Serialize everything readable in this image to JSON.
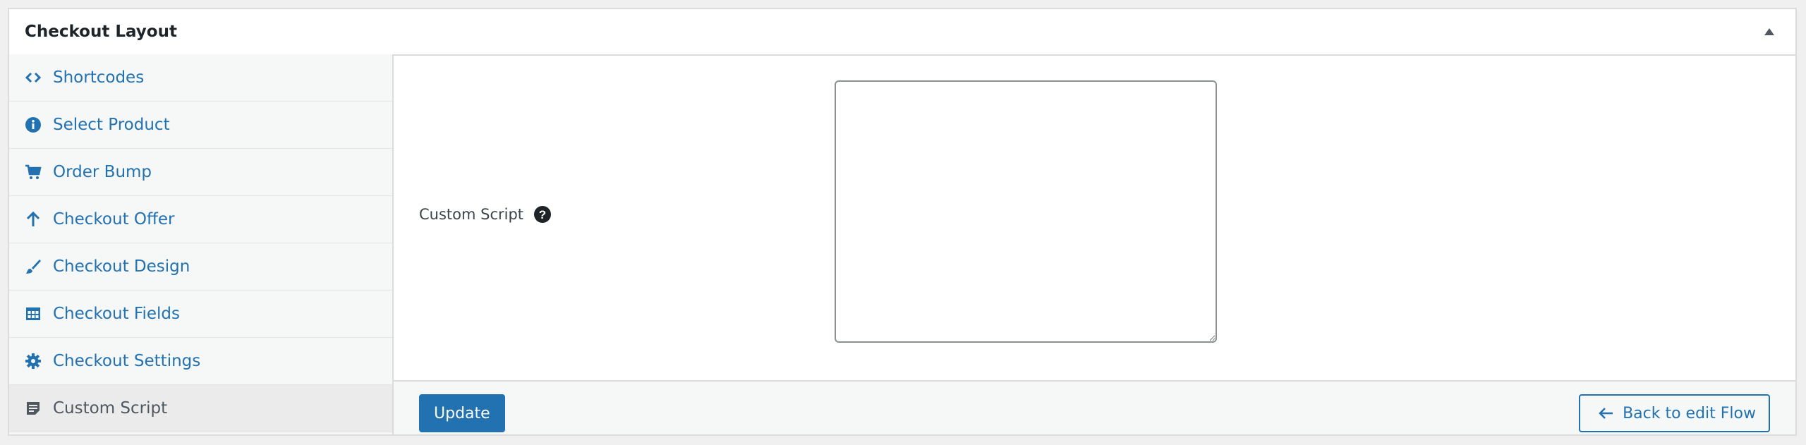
{
  "panel": {
    "title": "Checkout Layout",
    "toggle_icon": "triangle-up-icon"
  },
  "sidebar": {
    "items": [
      {
        "label": "Shortcodes",
        "icon": "code-brackets-icon"
      },
      {
        "label": "Select Product",
        "icon": "info-icon"
      },
      {
        "label": "Order Bump",
        "icon": "cart-icon"
      },
      {
        "label": "Checkout Offer",
        "icon": "arrow-up-icon"
      },
      {
        "label": "Checkout Design",
        "icon": "brush-icon"
      },
      {
        "label": "Checkout Fields",
        "icon": "table-grid-icon"
      },
      {
        "label": "Checkout Settings",
        "icon": "gear-icon"
      },
      {
        "label": "Custom Script",
        "icon": "document-text-icon",
        "active": true
      }
    ]
  },
  "main": {
    "field_label": "Custom Script",
    "help_icon": "question-circle-icon",
    "script_value": ""
  },
  "footer": {
    "update_label": "Update",
    "back_label": "Back to edit Flow",
    "back_icon": "arrow-left-icon"
  },
  "colors": {
    "accent": "#2271b1",
    "sidebar_bg": "#f6f7f7",
    "active_item_bg": "#ebebeb",
    "border": "#dcdcde"
  }
}
